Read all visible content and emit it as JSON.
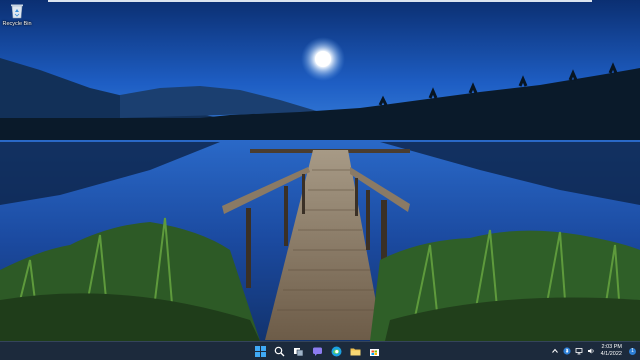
{
  "desktop": {
    "icons": [
      {
        "label": "Recycle Bin",
        "icon": "recycle-bin-icon"
      }
    ]
  },
  "taskbar": {
    "pinned": [
      {
        "icon": "windows-start-icon"
      },
      {
        "icon": "search-icon"
      },
      {
        "icon": "task-view-icon"
      },
      {
        "icon": "chat-icon"
      },
      {
        "icon": "edge-browser-icon"
      },
      {
        "icon": "file-explorer-icon"
      },
      {
        "icon": "store-icon"
      }
    ],
    "tray": {
      "icons": [
        "chevron-up-icon",
        "bluetooth-icon",
        "network-icon",
        "volume-icon"
      ],
      "time": "2:03 PM",
      "date": "4/1/2022",
      "notifications": "1"
    }
  },
  "colors": {
    "sky_top": "#0a2b66",
    "sky_mid": "#1d57b8",
    "water": "#1a4aa5",
    "taskbar": "#1c2a3c",
    "accent": "#2d7fd6"
  }
}
